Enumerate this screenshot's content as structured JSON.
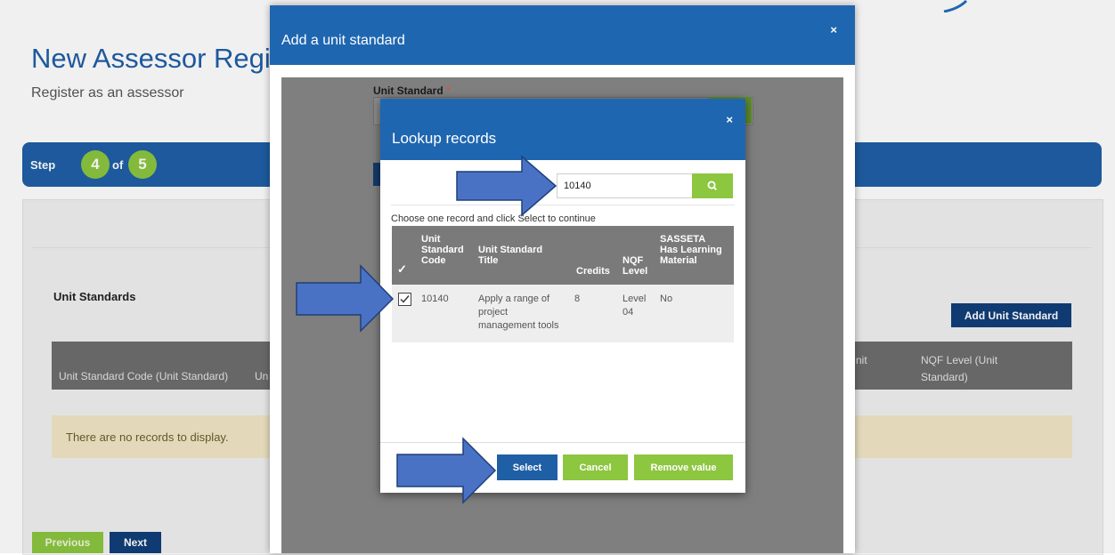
{
  "page": {
    "title": "New Assessor Regis",
    "subtitle": "Register as an assessor",
    "step": {
      "label": "Step",
      "current": "4",
      "of_label": "of",
      "total": "5"
    },
    "unit_standards_heading": "Unit Standards",
    "add_unit_standard_label": "Add Unit Standard",
    "grid_columns": [
      "Unit Standard Code (Unit Standard)",
      "Un",
      "nit",
      "NQF Level (Unit",
      "Standard)"
    ],
    "no_records": "There are no records to display.",
    "previous_label": "Previous",
    "next_label": "Next"
  },
  "outer_modal": {
    "title": "Add a unit standard",
    "close": "×",
    "field_label": "Unit Standard",
    "required_mark": "*"
  },
  "lookup_modal": {
    "title": "Lookup records",
    "close": "×",
    "search_value": "10140",
    "instruction": "Choose one record and click Select to continue",
    "columns": {
      "check": "✓",
      "code": [
        "Unit",
        "Standard",
        "Code"
      ],
      "title": [
        "Unit Standard",
        "Title"
      ],
      "credits": "Credits",
      "nqf": [
        "NQF",
        "Level"
      ],
      "sasseta": [
        "SASSETA",
        "Has Learning",
        "Material"
      ]
    },
    "row": {
      "checked": true,
      "code": "10140",
      "title": [
        "Apply a range of",
        "project",
        "management tools"
      ],
      "credits": "8",
      "nqf": [
        "Level",
        "04"
      ],
      "sasseta": "No"
    },
    "buttons": {
      "select": "Select",
      "cancel": "Cancel",
      "remove": "Remove value"
    }
  },
  "icons": {
    "search": "search-icon",
    "close": "close-icon",
    "check": "checkmark-icon",
    "annotation_arrow": "arrow-right-icon"
  },
  "colors": {
    "primary_blue": "#1f66b0",
    "dark_blue": "#123f7a",
    "green": "#8dc63f",
    "arrow_fill": "#4a72c4",
    "arrow_stroke": "#1f3f7a",
    "grid_header": "#7a7a7a"
  }
}
